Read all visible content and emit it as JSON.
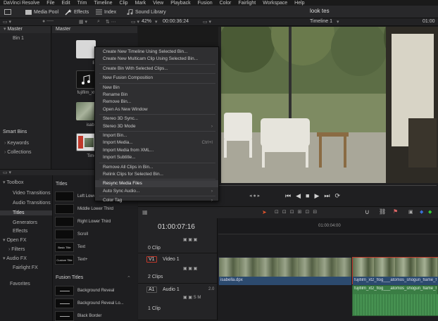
{
  "menubar": [
    "DaVinci Resolve",
    "File",
    "Edit",
    "Trim",
    "Timeline",
    "Clip",
    "Mark",
    "View",
    "Playback",
    "Fusion",
    "Color",
    "Fairlight",
    "Workspace",
    "Help"
  ],
  "toolbar": {
    "media_pool": "Media Pool",
    "effects": "Effects",
    "index": "Index",
    "sound_library": "Sound Library",
    "project_title": "look tes"
  },
  "viewer": {
    "zoom": "42%",
    "timecode": "00:00:36:24",
    "timeline_name": "Timeline 1",
    "timecode_right": "01:00"
  },
  "bins": {
    "header": "Master",
    "items": [
      "Bin 1"
    ],
    "smart_bins_header": "Smart Bins",
    "smart_bins": [
      "Keywords",
      "Collections"
    ]
  },
  "media_pool": {
    "header": "Master",
    "clips": [
      {
        "label": "Bi"
      },
      {
        "label": "fujifilm_xt"
      },
      {
        "label": "isabe"
      },
      {
        "label": "Time"
      }
    ]
  },
  "effects": {
    "tree": [
      {
        "label": "Toolbox",
        "type": "group",
        "open": true
      },
      {
        "label": "Video Transitions",
        "type": "child"
      },
      {
        "label": "Audio Transitions",
        "type": "child"
      },
      {
        "label": "Titles",
        "type": "child",
        "selected": true
      },
      {
        "label": "Generators",
        "type": "child"
      },
      {
        "label": "Effects",
        "type": "child"
      },
      {
        "label": "Open FX",
        "type": "group",
        "open": true
      },
      {
        "label": "Filters",
        "type": "child2"
      },
      {
        "label": "Audio FX",
        "type": "group",
        "open": true
      },
      {
        "label": "Fairlight FX",
        "type": "child"
      }
    ],
    "favorites": "Favorites",
    "titles_header": "Titles",
    "titles": [
      {
        "thumb": "",
        "label": "Left Lower Third"
      },
      {
        "thumb": "",
        "label": "Middle Lower Third"
      },
      {
        "thumb": "",
        "label": "Right Lower Third"
      },
      {
        "thumb": "",
        "label": "Scroll"
      },
      {
        "thumb": "Basic Title",
        "label": "Text"
      },
      {
        "thumb": "Custom Title",
        "label": "Text+"
      }
    ],
    "fusion_titles_header": "Fusion Titles",
    "fusion_titles": [
      {
        "label": "Background Reveal"
      },
      {
        "label": "Background Reveal Lo..."
      },
      {
        "label": "Black Border"
      }
    ]
  },
  "context_menu": {
    "items": [
      {
        "label": "Create New Timeline Using Selected Bin...",
        "disabled": false
      },
      {
        "label": "Create New Multicam Clip Using Selected Bin...",
        "disabled": false
      },
      {
        "sep": true
      },
      {
        "label": "Create Bin With Selected Clips...",
        "disabled": false
      },
      {
        "sep": true
      },
      {
        "label": "New Fusion Composition",
        "disabled": false
      },
      {
        "sep": true
      },
      {
        "label": "New Bin",
        "disabled": false
      },
      {
        "label": "Rename Bin",
        "disabled": false
      },
      {
        "label": "Remove Bin...",
        "disabled": false
      },
      {
        "label": "Open As New Window",
        "disabled": false
      },
      {
        "sep": true
      },
      {
        "label": "Stereo 3D Sync...",
        "disabled": false
      },
      {
        "label": "Stereo 3D Mode",
        "disabled": false,
        "submenu": true
      },
      {
        "sep": true
      },
      {
        "label": "Import Bin...",
        "disabled": false
      },
      {
        "label": "Import Media...",
        "disabled": false,
        "shortcut": "Ctrl+I"
      },
      {
        "label": "Import Media from XML...",
        "disabled": false
      },
      {
        "label": "Import Subtitle...",
        "disabled": false
      },
      {
        "sep": true
      },
      {
        "label": "Remove All Clips in Bin...",
        "disabled": false
      },
      {
        "label": "Relink Clips for Selected Bin...",
        "disabled": false
      },
      {
        "sep": true
      },
      {
        "label": "Resync Media Files",
        "disabled": false,
        "highlighted": true
      },
      {
        "label": "Auto Sync Audio...",
        "disabled": false,
        "submenu": true
      },
      {
        "sep": true
      },
      {
        "label": "Color Tag",
        "disabled": false,
        "submenu": true
      }
    ]
  },
  "timeline": {
    "timecode": "01:00:07:16",
    "ruler_mark": "01:00:04:00",
    "tracks": [
      {
        "id": "",
        "name": "",
        "clips": "0 Clip"
      },
      {
        "id": "V1",
        "name": "Video 1",
        "clips": "2 Clips"
      },
      {
        "id": "A1",
        "name": "Audio 1",
        "clips": "1 Clip",
        "level": "2.0"
      }
    ],
    "clip_names": {
      "v1a": "isabella.dpx",
      "v1b": "fujifilm_xt2_flog___atomos_shogun_flame_f",
      "a1": "fujifilm_xt2_flog___atomos_shogun_flame_f"
    }
  },
  "colors": {
    "accent": "#c0392b",
    "audio_clip": "#3a7d44",
    "video_clip_bar": "#2c4a6e"
  }
}
